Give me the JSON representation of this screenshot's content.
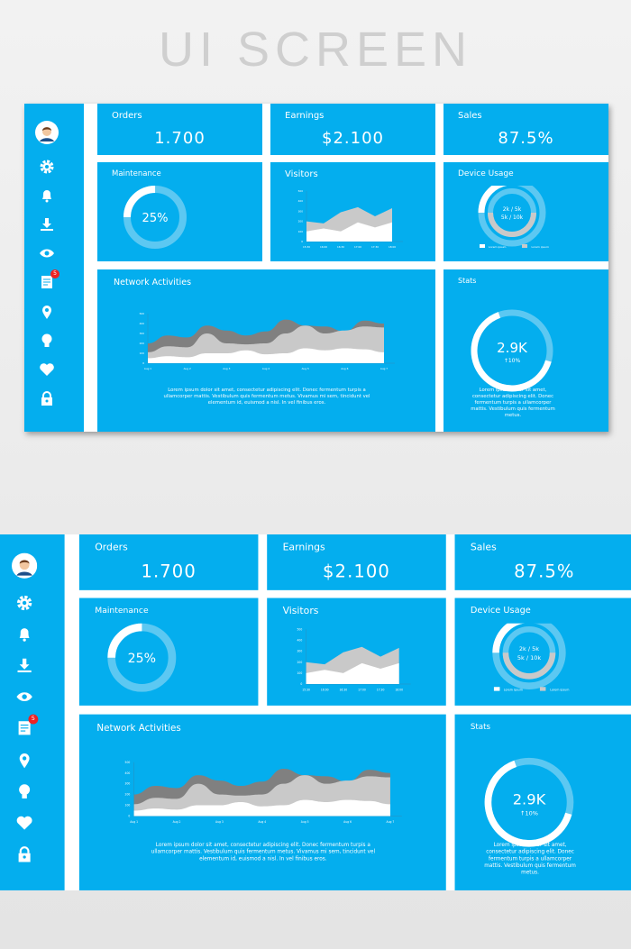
{
  "title": "UI SCREEN",
  "colors": {
    "card": "#04aeee",
    "ring": "#5cc8f2",
    "gray": "#c9c9c9",
    "dark": "#808080"
  },
  "sidebar": {
    "icons": [
      "avatar",
      "gear-icon",
      "bell-icon",
      "download-icon",
      "eye-icon",
      "document-icon",
      "location-pin-icon",
      "lightbulb-icon",
      "heart-icon",
      "lock-icon"
    ],
    "badge": "5"
  },
  "orders": {
    "label": "Orders",
    "value": "1.700"
  },
  "earnings": {
    "label": "Earnings",
    "value": "$2.100"
  },
  "sales": {
    "label": "Sales",
    "value": "87.5%"
  },
  "maintenance": {
    "label": "Maintenance",
    "value": "25%",
    "percent": 25
  },
  "visitors": {
    "label": "Visitors",
    "chart_data": {
      "type": "area",
      "categories": [
        "15:30",
        "16:00",
        "16:30",
        "17:00",
        "17:30",
        "18:00"
      ],
      "yticks": [
        0,
        100,
        200,
        300,
        400,
        500
      ],
      "ylim": [
        0,
        500
      ],
      "series": [
        {
          "values": [
            100,
            130,
            100,
            190,
            140,
            190
          ]
        },
        {
          "values": [
            200,
            180,
            290,
            340,
            250,
            330
          ]
        }
      ]
    }
  },
  "device": {
    "label": "Device Usage",
    "line1": "2k / 5k",
    "line2": "5k / 10k",
    "outer_percent": 25,
    "inner_percent": 50,
    "legend": [
      "Lorem ipsum",
      "Lorem ipsum"
    ]
  },
  "network": {
    "label": "Network Activities",
    "chart_data": {
      "type": "area",
      "categories": [
        "Aug 1",
        "Aug 2",
        "Aug 3",
        "Aug 4",
        "Aug 5",
        "Aug 6",
        "Aug 7"
      ],
      "yticks": [
        0,
        100,
        200,
        300,
        400,
        500
      ],
      "ylim": [
        0,
        500
      ],
      "series": [
        {
          "values": [
            50,
            70,
            60,
            100,
            100,
            130,
            90,
            100,
            150,
            130,
            150,
            140,
            110
          ]
        },
        {
          "values": [
            110,
            170,
            160,
            300,
            200,
            190,
            200,
            300,
            380,
            300,
            330,
            370,
            360
          ]
        },
        {
          "values": [
            200,
            280,
            260,
            380,
            330,
            280,
            320,
            440,
            380,
            370,
            320,
            430,
            400
          ]
        }
      ]
    },
    "text": "Lorem ipsum dolor sit amet, consectetur adipiscing elit. Donec fermentum turpis a ullamcorper mattis. Vestibulum quis fermentum metus. Vivamus mi sem, tincidunt vel elementum id, euismod a nisl. In vel finibus eros."
  },
  "stats": {
    "label": "Stats",
    "value": "2.9K",
    "change": "↑10%",
    "percent": 65,
    "text": "Lorem ipsum dolor sit amet, consectetur adipiscing elit. Donec fermentum turpis a ullamcorper mattis. Vestibulum quis fermentum metus."
  }
}
